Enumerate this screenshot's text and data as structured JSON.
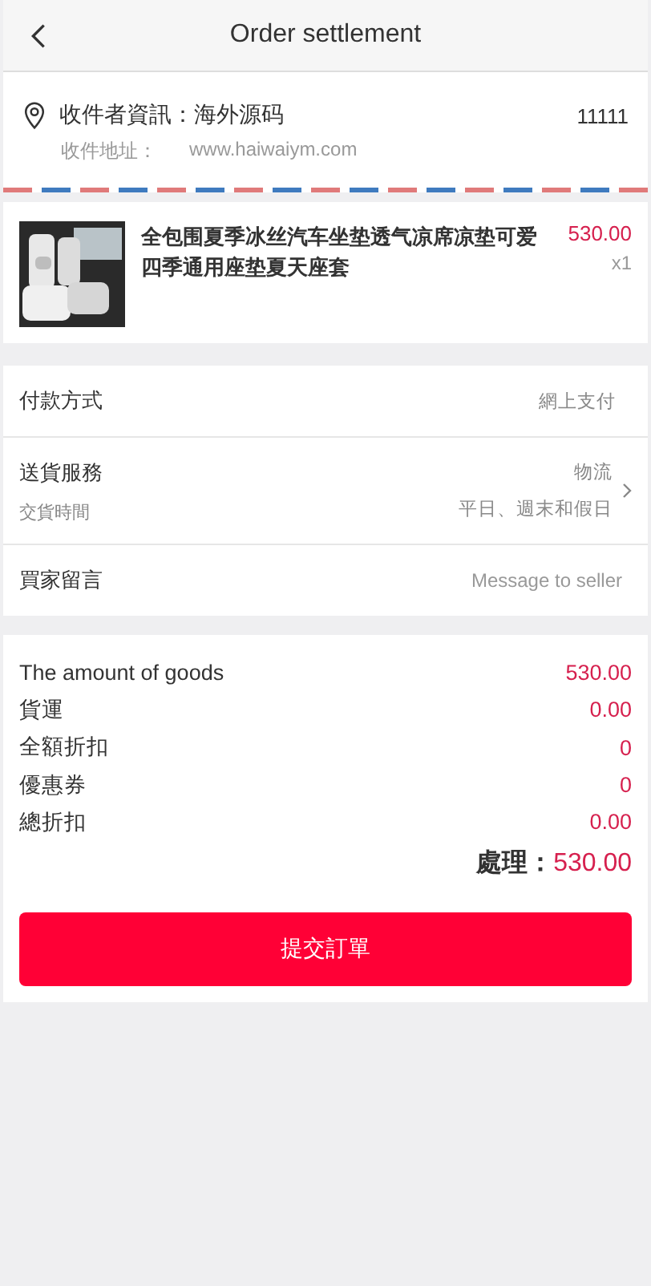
{
  "header": {
    "title": "Order settlement"
  },
  "address": {
    "recipient": "收件者資訊：海外源码",
    "phone": "11111",
    "address_label": "收件地址：",
    "address": "www.haiwaiym.com"
  },
  "product": {
    "name": "全包围夏季冰丝汽车坐垫透气凉席凉垫可爱四季通用座垫夏天座套",
    "price": "530.00",
    "quantity": "x1"
  },
  "options": [
    {
      "kind": "value",
      "label": "付款方式",
      "value": "網上支付"
    },
    {
      "kind": "link",
      "label": "送貨服務",
      "sublabel": "交貨時間",
      "value": "物流",
      "subvalue": "平日、週末和假日"
    },
    {
      "kind": "input",
      "label": "買家留言",
      "placeholder": "Message to seller"
    }
  ],
  "summary": [
    {
      "label": "The amount of goods",
      "value": "530.00"
    },
    {
      "label": "貨運",
      "value": "0.00"
    },
    {
      "label": "全額折扣",
      "value": "0"
    },
    {
      "label": "優惠券",
      "value": "0"
    },
    {
      "label": "總折扣",
      "value": "0.00"
    }
  ],
  "total": {
    "label": "處理：",
    "value": "530.00"
  },
  "submit_button": "提交訂單"
}
